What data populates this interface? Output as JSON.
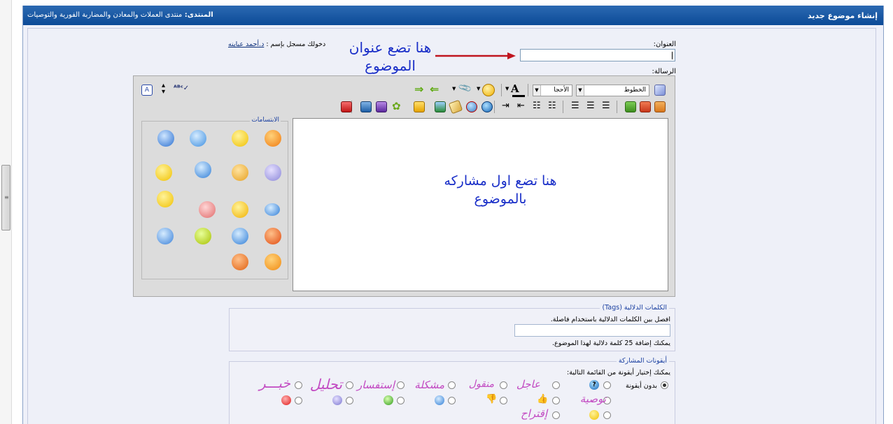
{
  "header": {
    "title": "إنشاء موضوع جديد",
    "forum_label": "المنتدى:",
    "forum_name": "منتدى العملات والمعادن والمضاربة الفورية والتوصيات"
  },
  "form": {
    "title_label": "العنوان:",
    "message_label": "الرسالة:",
    "logged_in_prefix": "دخولك مسجل بإسم :",
    "username": "د.أحمد عباينه",
    "title_value": "|"
  },
  "annotations": {
    "title_note_line1": "هنا تضع عنوان",
    "title_note_line2": "الموضوع",
    "post_note_line1": "هنا تضع  اول مشاركه",
    "post_note_line2": "بالموضوع"
  },
  "editor": {
    "font_select": "الخطوط",
    "size_select": "الأحجا",
    "smilies_legend": "الابتسامات"
  },
  "tags": {
    "legend": "الكلمات الدلالية (Tags)",
    "instruction": "افصل بين الكلمات الدلالية باستخدام فاصلة.",
    "note": "يمكنك إضافة 25 كلمة دلالية لهذا الموضوع.",
    "input_value": ""
  },
  "post_icons": {
    "legend": "أيقونات المشاركة",
    "instruction": "يمكنك إختيار أيقونة من القائمة التالية:",
    "no_icon": "بدون أيقونة",
    "labels": [
      "عاجل",
      "منقول",
      "مشكلة",
      "إستفسار",
      "تحليل",
      "خبـــر",
      "توصية",
      "إقتراح"
    ]
  },
  "colors": {
    "header_bg": "#1559a6",
    "annotation_text": "#1a2fc8",
    "arrow": "#c0151f",
    "icon_label": "#c24ac2"
  }
}
